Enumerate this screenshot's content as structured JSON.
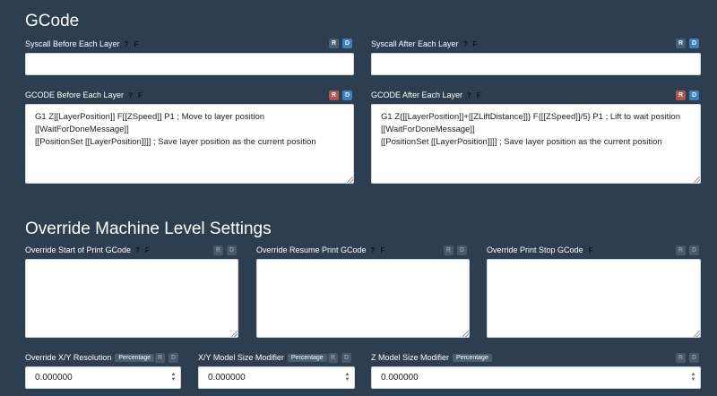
{
  "gcode": {
    "title": "GCode",
    "syscall_before": {
      "label": "Syscall Before Each Layer",
      "help": "?",
      "flag": "F",
      "value": ""
    },
    "syscall_after": {
      "label": "Syscall After Each Layer",
      "help": "?",
      "flag": "F",
      "value": ""
    },
    "gcode_before": {
      "label": "GCODE Before Each Layer",
      "help": "?",
      "flag": "F",
      "value": "G1 Z[[LayerPosition]] F[[ZSpeed]] P1 ; Move to layer position\n[[WaitForDoneMessage]]\n[[PositionSet [[LayerPosition]]]] ; Save layer position as the current position"
    },
    "gcode_after": {
      "label": "GCODE After Each Layer",
      "help": "?",
      "flag": "F",
      "value": "G1 Z{[[LayerPosition]]+[[ZLiftDistance]]} F{[[ZSpeed]]/5} P1 ; Lift to wait position\n[[WaitForDoneMessage]]\n[[PositionSet [[LayerPosition]]]] ; Save layer position as the current position"
    }
  },
  "override": {
    "title": "Override Machine Level Settings",
    "start_print": {
      "label": "Override Start of Print GCode",
      "help": "?",
      "flag": "F",
      "value": ""
    },
    "resume_print": {
      "label": "Override Resume Print GCode",
      "help": "?",
      "flag": "F",
      "value": ""
    },
    "stop_print": {
      "label": "Override Print Stop GCode",
      "flag": "F",
      "value": ""
    },
    "xy_resolution": {
      "label": "Override X/Y Resolution",
      "badge": "Percentage",
      "value": "0.000000"
    },
    "xy_size": {
      "label": "X/Y Model Size Modifier",
      "badge": "Percentage",
      "value": "0.000000"
    },
    "z_size": {
      "label": "Z Model Size Modifier",
      "badge": "Percentage",
      "value": "0.000000"
    }
  },
  "buttons": {
    "r": "R",
    "d": "D"
  },
  "colors": {
    "background": "#2d3e50",
    "d_button": "#3e7fc0",
    "r_button_active": "#a8584f"
  }
}
